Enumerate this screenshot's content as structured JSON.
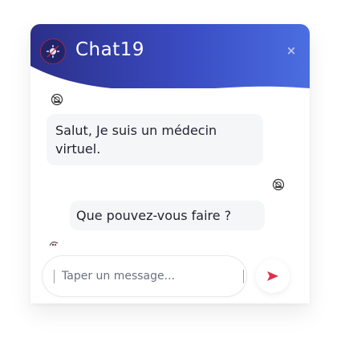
{
  "header": {
    "title": "Chat19",
    "logo_icon": "virus-logo-icon",
    "close_label": "×",
    "gradient_start": "#2b2f88",
    "gradient_end": "#4a6ee0"
  },
  "messages": [
    {
      "sender": "bot",
      "avatar_icon": "bot-avatar-icon",
      "text": "Salut, Je suis un médecin virtuel."
    },
    {
      "sender": "user",
      "avatar_icon": "user-avatar-icon",
      "text": "Que pouvez-vous faire ?"
    }
  ],
  "typing_indicator_icon": "bot-typing-icon",
  "composer": {
    "placeholder": "Taper un message...",
    "value": "",
    "send_icon": "send-icon",
    "send_color": "#e0304a"
  }
}
